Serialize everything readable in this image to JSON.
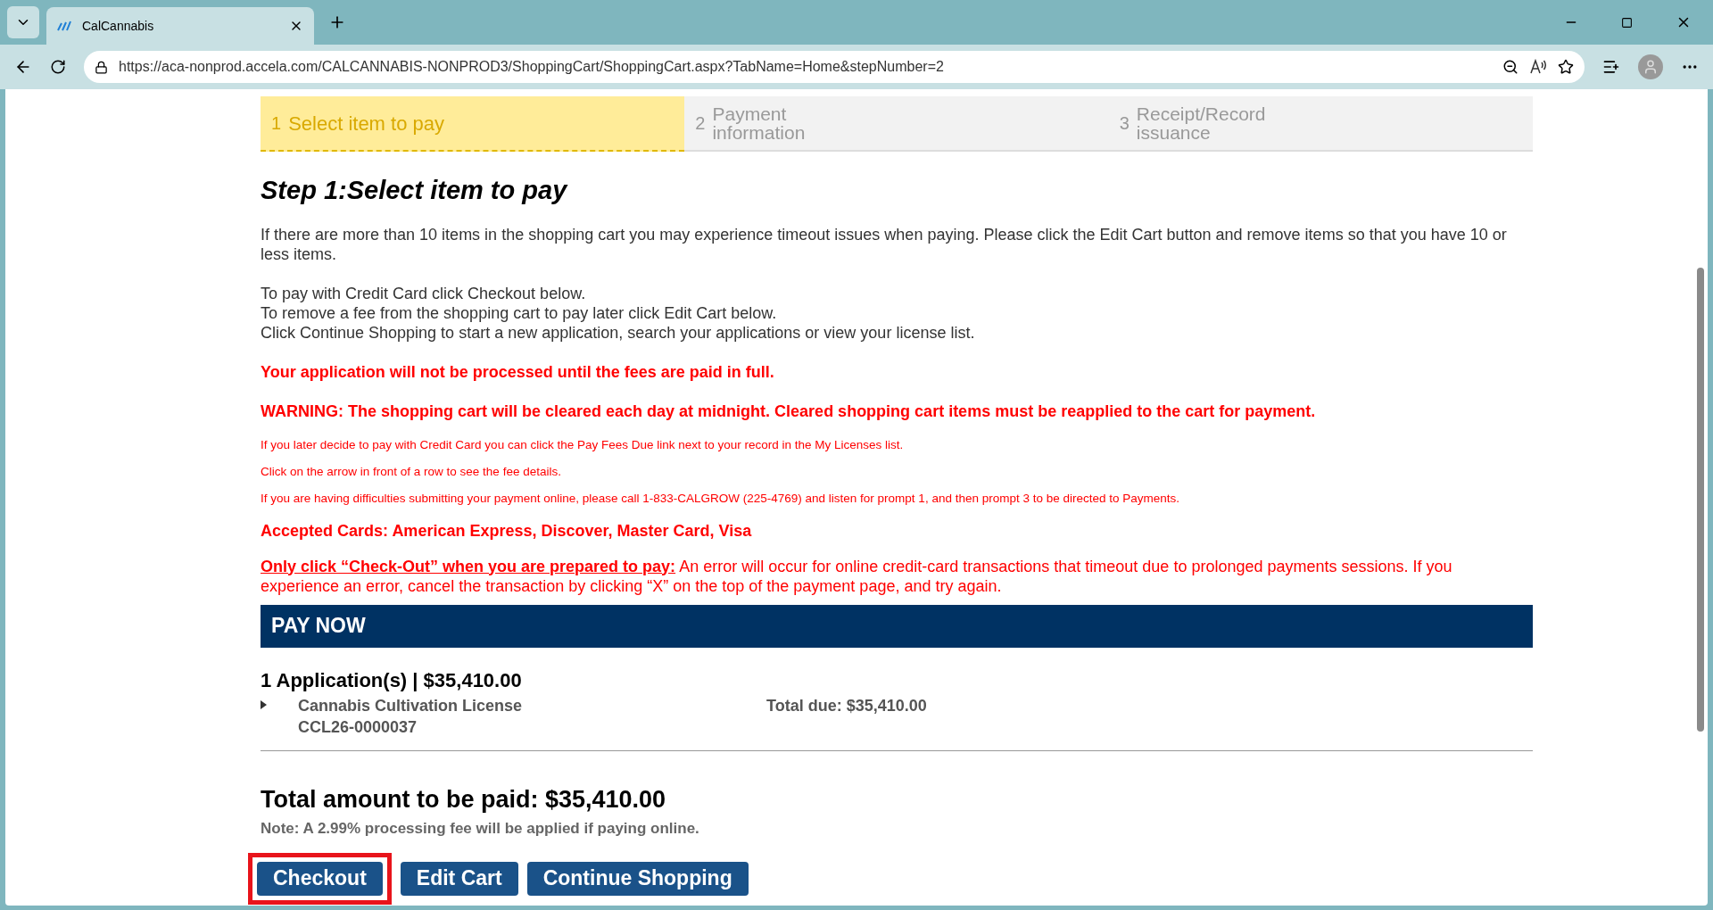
{
  "browser": {
    "tab_title": "CalCannabis",
    "url": "https://aca-nonprod.accela.com/CALCANNABIS-NONPROD3/ShoppingCart/ShoppingCart.aspx?TabName=Home&stepNumber=2"
  },
  "steps": [
    {
      "number": "1",
      "label": "Select item to pay",
      "selected": true
    },
    {
      "number": "2",
      "label": "Payment information",
      "selected": false
    },
    {
      "number": "3",
      "label": "Receipt/Record issuance",
      "selected": false
    }
  ],
  "heading": "Step 1:Select item to pay",
  "intro": [
    "If there are more than 10 items in the shopping cart you may experience timeout issues when paying.  Please click the Edit Cart button and remove items so that you have 10 or less items."
  ],
  "instructions": [
    "To pay with Credit Card click Checkout below.",
    "To remove a fee from the shopping cart to pay later click Edit Cart below.",
    "Click Continue Shopping to start a new application, search your applications or view your license list."
  ],
  "notices": [
    {
      "kind": "large",
      "text": "Your application will not be processed until the fees are paid in full."
    },
    {
      "kind": "large",
      "text": "WARNING: The shopping cart will be cleared each day at midnight.  Cleared shopping cart items must be reapplied to the cart for payment."
    },
    {
      "kind": "small",
      "text": "If you later decide to pay with Credit Card you can click the Pay Fees Due link next to your record in the My Licenses list."
    },
    {
      "kind": "small",
      "text": "Click on the arrow in front of a row to see the fee details."
    },
    {
      "kind": "small",
      "text": "If you are having difficulties submitting your payment online, please call 1-833-CALGROW (225-4769) and listen for prompt 1, and then prompt 3 to be directed to Payments."
    },
    {
      "kind": "large",
      "text": "Accepted Cards:  American Express, Discover, Master Card, Visa"
    }
  ],
  "checkout_warning": {
    "lead": "Only click “Check-Out” when you are prepared to pay:",
    "text": " An error will occur for online credit-card transactions that timeout due to prolonged payments sessions. If you experience an error, cancel the transaction by clicking “X” on the top of the payment page, and try again."
  },
  "pay_now": {
    "title": "PAY NOW",
    "group_title": "1 Application(s) | $35,410.00",
    "items": [
      {
        "name": "Cannabis Cultivation License",
        "record": "CCL26-0000037",
        "total": "Total due: $35,410.00",
        "expanded": false
      }
    ]
  },
  "total": {
    "label": "Total amount to be paid:",
    "amount": "$35,410.00",
    "note": "Note: A 2.99% processing fee will be applied if paying online."
  },
  "buttons": [
    {
      "label": "Checkout",
      "highlighted": true
    },
    {
      "label": "Edit Cart",
      "highlighted": false
    },
    {
      "label": "Continue Shopping",
      "highlighted": false
    }
  ]
}
